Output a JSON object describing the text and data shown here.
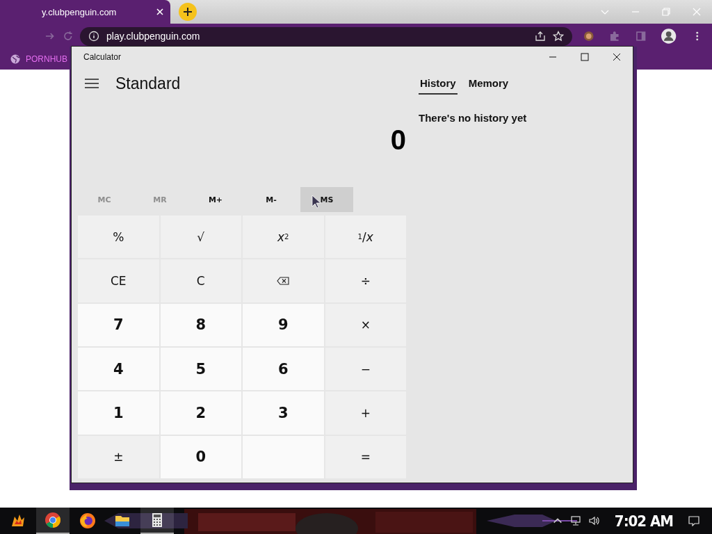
{
  "browser": {
    "tab_title": "y.clubpenguin.com",
    "url": "play.clubpenguin.com",
    "bookmarks": [
      {
        "label": "PORNHUB"
      }
    ]
  },
  "calculator": {
    "title": "Calculator",
    "mode": "Standard",
    "display": "0",
    "memory": [
      {
        "label": "MC",
        "disabled": true
      },
      {
        "label": "MR",
        "disabled": true
      },
      {
        "label": "M+",
        "disabled": false
      },
      {
        "label": "M-",
        "disabled": false
      },
      {
        "label": "MS",
        "disabled": false,
        "hovered": true
      }
    ],
    "keys": [
      {
        "kind": "function",
        "label": "%"
      },
      {
        "kind": "function",
        "label": "√"
      },
      {
        "kind": "function",
        "label": "*x*$^{2}$"
      },
      {
        "kind": "function",
        "label": "$^{1}$/*x*"
      },
      {
        "kind": "function",
        "label": "CE"
      },
      {
        "kind": "function",
        "label": "C"
      },
      {
        "kind": "backspace"
      },
      {
        "kind": "function",
        "label": "÷"
      },
      {
        "kind": "digit",
        "label": "7"
      },
      {
        "kind": "digit",
        "label": "8"
      },
      {
        "kind": "digit",
        "label": "9"
      },
      {
        "kind": "function",
        "label": "×"
      },
      {
        "kind": "digit",
        "label": "4"
      },
      {
        "kind": "digit",
        "label": "5"
      },
      {
        "kind": "digit",
        "label": "6"
      },
      {
        "kind": "function",
        "label": "−"
      },
      {
        "kind": "digit",
        "label": "1"
      },
      {
        "kind": "digit",
        "label": "2"
      },
      {
        "kind": "digit",
        "label": "3"
      },
      {
        "kind": "function",
        "label": "+"
      },
      {
        "kind": "function",
        "label": "±"
      },
      {
        "kind": "digit",
        "label": "0"
      },
      {
        "kind": "digit"
      },
      {
        "kind": "function",
        "label": "="
      }
    ],
    "panel_tabs": [
      {
        "label": "History",
        "selected": true
      },
      {
        "label": "Memory",
        "selected": false
      }
    ],
    "history_message": "There's no history yet"
  },
  "taskbar": {
    "apps": [
      {
        "kind": "game",
        "active": false
      },
      {
        "kind": "chrome",
        "active": true
      },
      {
        "kind": "firefox",
        "active": false
      },
      {
        "kind": "folder",
        "active": false
      },
      {
        "kind": "calculator",
        "active": true
      }
    ],
    "time": "7:02 AM"
  }
}
